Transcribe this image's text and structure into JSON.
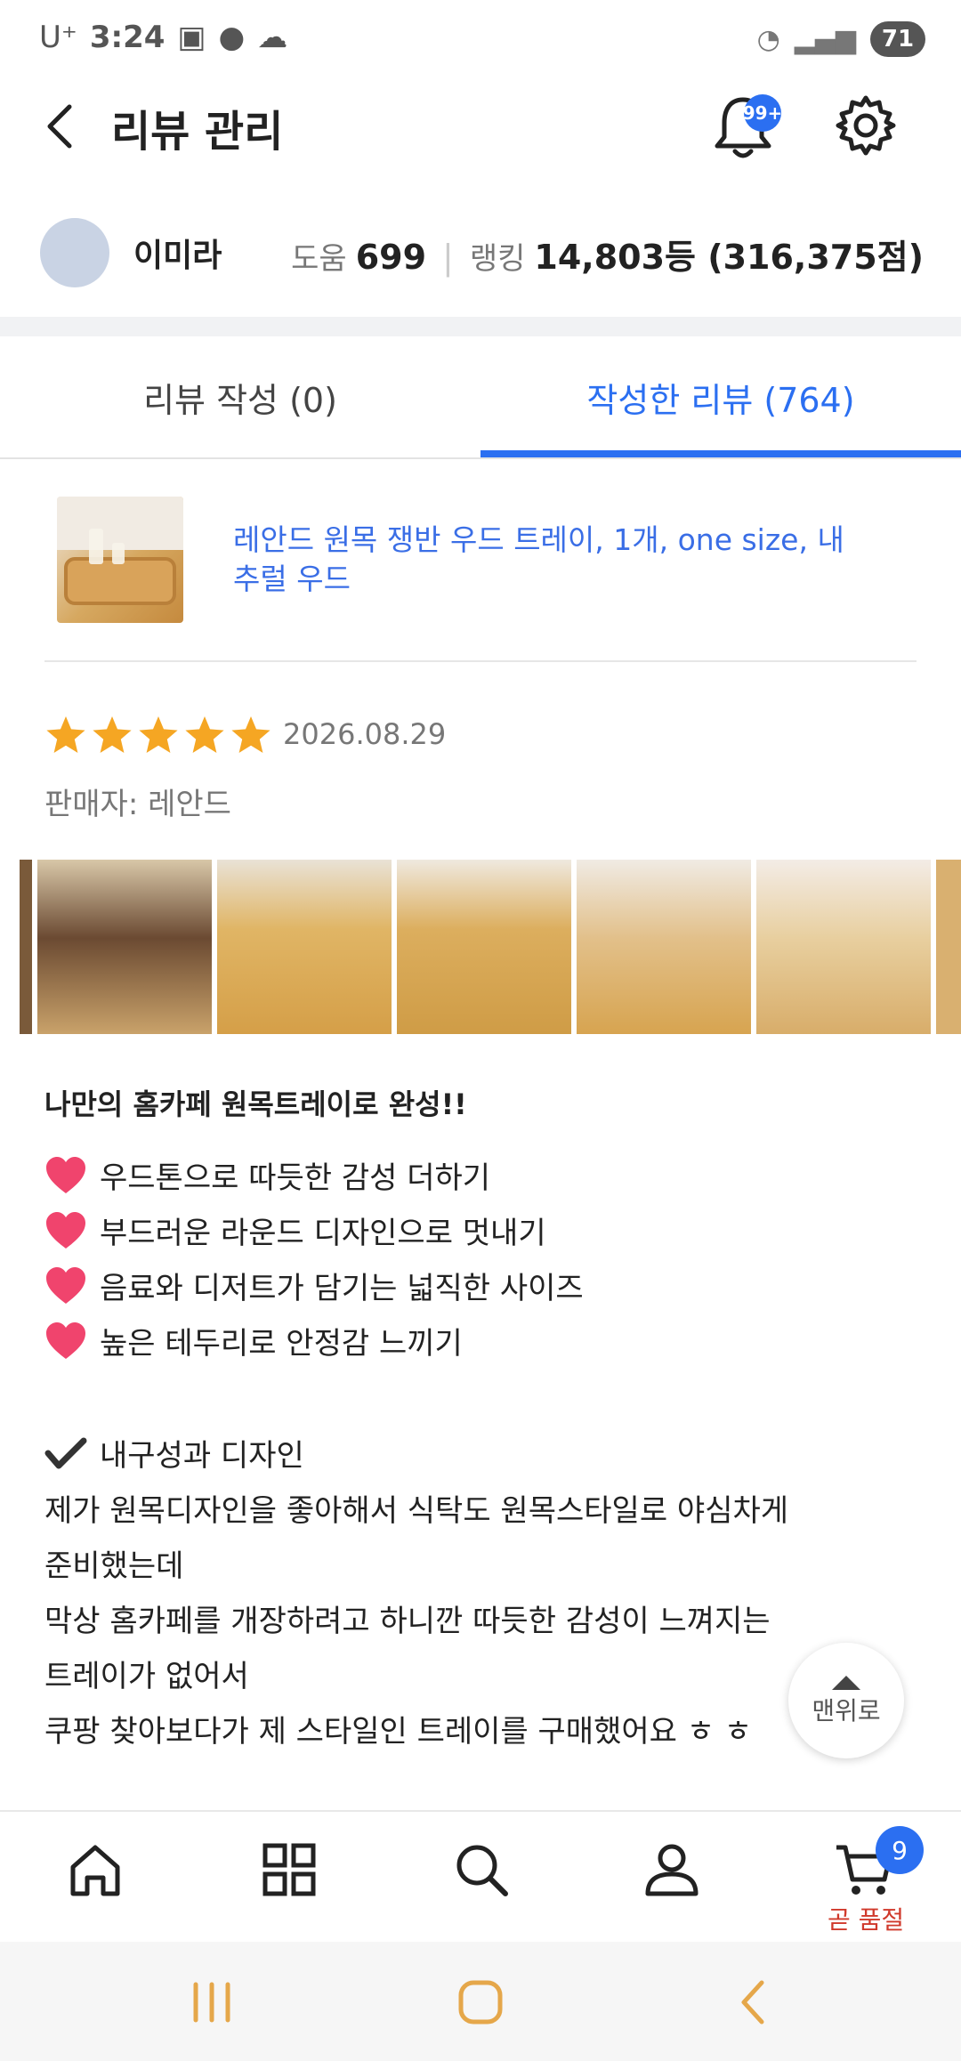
{
  "status_bar": {
    "carrier": "U⁺",
    "time": "3:24",
    "battery": "71"
  },
  "header": {
    "title": "리뷰 관리",
    "notification_badge": "99+"
  },
  "profile": {
    "name": "이미라",
    "help_label": "도움",
    "help_value": "699",
    "ranking_label": "랭킹",
    "ranking_value": "14,803등 (316,375점)"
  },
  "tabs": [
    {
      "label": "리뷰 작성 (0)",
      "active": false
    },
    {
      "label": "작성한 리뷰 (764)",
      "active": true
    }
  ],
  "review": {
    "product_name": "레안드 원목 쟁반 우드 트레이, 1개, one size, 내추럴 우드",
    "rating": 5,
    "date": "2026.08.29",
    "seller": "판매자: 레안드",
    "headline": "나만의 홈카페 원목트레이로 완성!!",
    "bullets": [
      "우드톤으로 따듯한 감성 더하기",
      "부드러운 라운드 디자인으로 멋내기",
      "음료와 디저트가 담기는 넓직한 사이즈",
      "높은 테두리로 안정감 느끼기"
    ],
    "section_title": "내구성과 디자인",
    "paragraph": [
      "제가 원목디자인을 좋아해서 식탁도 원목스타일로 야심차게",
      "준비했는데",
      "막상 홈카페를 개장하려고 하니깐 따듯한 감성이 느껴지는",
      "트레이가 없어서",
      "쿠팡 찾아보다가 제 스타일인 트레이를 구매했어요  ㅎ ㅎ"
    ]
  },
  "scroll_top_label": "맨위로",
  "bottom_nav": {
    "cart_count": "9",
    "cart_status": "곧 품절"
  },
  "colors": {
    "accent": "#2b6ff1",
    "star": "#f5a623",
    "heart": "#f0446d",
    "soldout": "#d0392b"
  }
}
